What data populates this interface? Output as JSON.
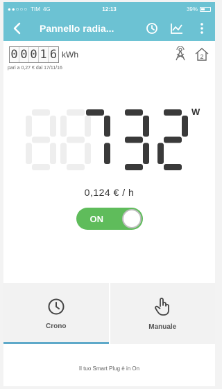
{
  "status_bar": {
    "carrier": "TIM",
    "network": "4G",
    "time": "12:13",
    "battery": "39%"
  },
  "app_bar": {
    "title": "Pannello radia...",
    "icons": [
      "back-chevron-icon",
      "clock-icon",
      "chart-icon",
      "more-vertical-icon"
    ]
  },
  "meter": {
    "digits": [
      "0",
      "0",
      "0",
      "1",
      "6"
    ],
    "unit": "kWh",
    "rate_note": "pari a 0,27 € dal 17/11/16",
    "icons": [
      "tower-icon",
      "home-2-icon"
    ],
    "home_badge": "2"
  },
  "power": {
    "value": "732",
    "unit": "W",
    "cost": "0,124 € / h"
  },
  "toggle": {
    "label": "ON",
    "state": "on",
    "color": "#5fbc5b"
  },
  "modes": [
    {
      "label": "Crono",
      "icon": "clock-icon",
      "active": true
    },
    {
      "label": "Manuale",
      "icon": "hand-pointer-icon",
      "active": false
    }
  ],
  "footer": {
    "message": "Il tuo Smart Plug è in On"
  },
  "colors": {
    "accent": "#6cc2d3",
    "on_green": "#5fbc5b",
    "tab_indicator": "#5ea9c9"
  }
}
